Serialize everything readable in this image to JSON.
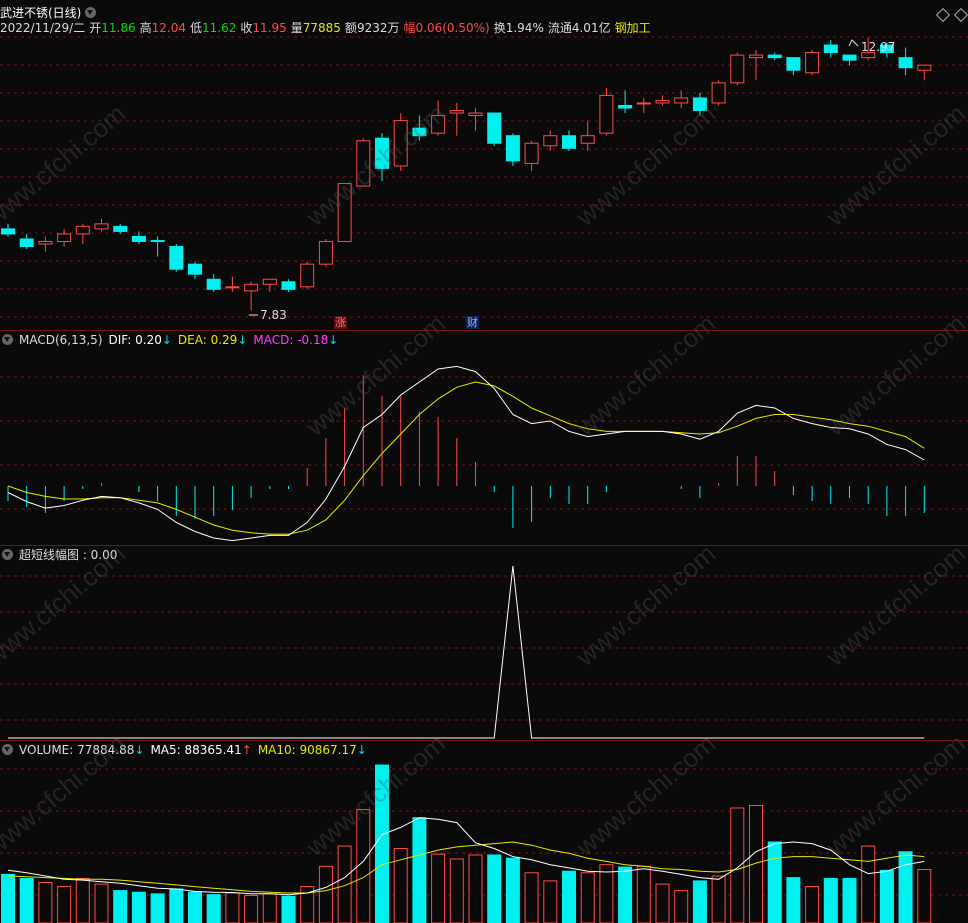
{
  "header": {
    "name": "武进不锈(日线)",
    "date": "2022/11/29/二",
    "open_label": "开",
    "open": "11.86",
    "high_label": "高",
    "high": "12.04",
    "low_label": "低",
    "low": "11.62",
    "close_label": "收",
    "close": "11.95",
    "vol_label": "量",
    "vol": "77885",
    "amount_label": "额",
    "amount": "9232万",
    "change_label": "幅",
    "change": "0.06(0.50%)",
    "turnover_label": "换",
    "turnover": "1.94%",
    "float_label": "流通",
    "float": "4.01亿",
    "sector": "钢加工"
  },
  "price_panel": {
    "high_marker": "12.97",
    "low_marker": "7.83",
    "event_zhang": "涨",
    "event_cai": "财"
  },
  "macd_panel": {
    "title": "MACD(6,13,5)",
    "dif_label": "DIF: 0.20",
    "dea_label": "DEA: 0.29",
    "macd_label": "MACD: -0.18",
    "arrow": "↓"
  },
  "short_panel": {
    "title": "超短线幅图 : 0.00"
  },
  "volume_panel": {
    "vol_label": "VOLUME: 77884.88",
    "ma5_label": "MA5: 88365.41",
    "ma10_label": "MA10: 90867.17",
    "arrow_down": "↓",
    "arrow_up": "↑"
  },
  "watermark": "www.cfchi.com",
  "colors": {
    "up": "#ff4a4a",
    "down": "#00f0f0",
    "dif": "#ffffff",
    "dea": "#e8e800",
    "macd": "#ff40ff",
    "grid": "#7a1111"
  },
  "chart_data": {
    "type": "candlestick",
    "candles": [
      {
        "o": 9.45,
        "h": 9.55,
        "l": 9.3,
        "c": 9.35
      },
      {
        "o": 9.25,
        "h": 9.35,
        "l": 9.05,
        "c": 9.1
      },
      {
        "o": 9.15,
        "h": 9.3,
        "l": 9.0,
        "c": 9.2
      },
      {
        "o": 9.2,
        "h": 9.45,
        "l": 9.1,
        "c": 9.35
      },
      {
        "o": 9.35,
        "h": 9.55,
        "l": 9.15,
        "c": 9.5
      },
      {
        "o": 9.45,
        "h": 9.65,
        "l": 9.4,
        "c": 9.55
      },
      {
        "o": 9.5,
        "h": 9.55,
        "l": 9.35,
        "c": 9.4
      },
      {
        "o": 9.3,
        "h": 9.4,
        "l": 9.15,
        "c": 9.2
      },
      {
        "o": 9.22,
        "h": 9.3,
        "l": 8.9,
        "c": 9.2
      },
      {
        "o": 9.1,
        "h": 9.15,
        "l": 8.6,
        "c": 8.65
      },
      {
        "o": 8.75,
        "h": 8.8,
        "l": 8.45,
        "c": 8.55
      },
      {
        "o": 8.45,
        "h": 8.55,
        "l": 8.2,
        "c": 8.25
      },
      {
        "o": 8.3,
        "h": 8.5,
        "l": 8.2,
        "c": 8.3
      },
      {
        "o": 8.22,
        "h": 8.4,
        "l": 7.83,
        "c": 8.35
      },
      {
        "o": 8.35,
        "h": 8.45,
        "l": 8.2,
        "c": 8.45
      },
      {
        "o": 8.4,
        "h": 8.45,
        "l": 8.2,
        "c": 8.25
      },
      {
        "o": 8.3,
        "h": 8.8,
        "l": 8.25,
        "c": 8.75
      },
      {
        "o": 8.75,
        "h": 9.25,
        "l": 8.7,
        "c": 9.2
      },
      {
        "o": 9.2,
        "h": 10.35,
        "l": 9.2,
        "c": 10.35
      },
      {
        "o": 10.3,
        "h": 11.25,
        "l": 10.3,
        "c": 11.2
      },
      {
        "o": 11.25,
        "h": 11.35,
        "l": 10.4,
        "c": 10.65
      },
      {
        "o": 10.7,
        "h": 11.75,
        "l": 10.6,
        "c": 11.6
      },
      {
        "o": 11.45,
        "h": 11.7,
        "l": 11.2,
        "c": 11.3
      },
      {
        "o": 11.35,
        "h": 12.0,
        "l": 11.3,
        "c": 11.7
      },
      {
        "o": 11.75,
        "h": 11.95,
        "l": 11.3,
        "c": 11.8
      },
      {
        "o": 11.7,
        "h": 11.85,
        "l": 11.4,
        "c": 11.75
      },
      {
        "o": 11.75,
        "h": 11.75,
        "l": 11.1,
        "c": 11.15
      },
      {
        "o": 11.3,
        "h": 11.35,
        "l": 10.7,
        "c": 10.8
      },
      {
        "o": 10.75,
        "h": 11.2,
        "l": 10.6,
        "c": 11.15
      },
      {
        "o": 11.1,
        "h": 11.4,
        "l": 11.0,
        "c": 11.3
      },
      {
        "o": 11.3,
        "h": 11.4,
        "l": 11.0,
        "c": 11.05
      },
      {
        "o": 11.15,
        "h": 11.6,
        "l": 11.0,
        "c": 11.3
      },
      {
        "o": 11.35,
        "h": 12.25,
        "l": 11.3,
        "c": 12.1
      },
      {
        "o": 11.9,
        "h": 12.2,
        "l": 11.75,
        "c": 11.85
      },
      {
        "o": 11.95,
        "h": 12.05,
        "l": 11.75,
        "c": 11.95
      },
      {
        "o": 11.95,
        "h": 12.1,
        "l": 11.9,
        "c": 12.0
      },
      {
        "o": 11.95,
        "h": 12.2,
        "l": 11.85,
        "c": 12.05
      },
      {
        "o": 12.05,
        "h": 12.15,
        "l": 11.7,
        "c": 11.8
      },
      {
        "o": 11.95,
        "h": 12.4,
        "l": 11.9,
        "c": 12.35
      },
      {
        "o": 12.35,
        "h": 12.95,
        "l": 12.3,
        "c": 12.9
      },
      {
        "o": 12.85,
        "h": 13.0,
        "l": 12.4,
        "c": 12.9
      },
      {
        "o": 12.9,
        "h": 12.95,
        "l": 12.8,
        "c": 12.85
      },
      {
        "o": 12.85,
        "h": 12.85,
        "l": 12.5,
        "c": 12.6
      },
      {
        "o": 12.55,
        "h": 13.0,
        "l": 12.5,
        "c": 12.95
      },
      {
        "o": 13.1,
        "h": 13.2,
        "l": 12.85,
        "c": 12.95
      },
      {
        "o": 12.9,
        "h": 12.9,
        "l": 12.7,
        "c": 12.8
      },
      {
        "o": 12.85,
        "h": 13.25,
        "l": 12.8,
        "c": 12.95
      },
      {
        "o": 13.1,
        "h": 13.15,
        "l": 12.85,
        "c": 12.95
      },
      {
        "o": 12.85,
        "h": 13.05,
        "l": 12.5,
        "c": 12.65
      },
      {
        "o": 12.6,
        "h": 12.7,
        "l": 12.4,
        "c": 12.7
      }
    ],
    "dif": [
      -0.05,
      -0.12,
      -0.17,
      -0.15,
      -0.11,
      -0.08,
      -0.09,
      -0.13,
      -0.18,
      -0.28,
      -0.35,
      -0.4,
      -0.42,
      -0.4,
      -0.38,
      -0.38,
      -0.28,
      -0.1,
      0.15,
      0.45,
      0.55,
      0.7,
      0.8,
      0.9,
      0.92,
      0.88,
      0.75,
      0.55,
      0.48,
      0.5,
      0.42,
      0.38,
      0.4,
      0.42,
      0.42,
      0.42,
      0.4,
      0.36,
      0.42,
      0.56,
      0.62,
      0.6,
      0.52,
      0.48,
      0.45,
      0.44,
      0.4,
      0.32,
      0.28,
      0.2
    ],
    "dea": [
      0.0,
      -0.05,
      -0.08,
      -0.1,
      -0.1,
      -0.09,
      -0.09,
      -0.11,
      -0.13,
      -0.18,
      -0.24,
      -0.3,
      -0.34,
      -0.36,
      -0.37,
      -0.37,
      -0.34,
      -0.26,
      -0.11,
      0.08,
      0.25,
      0.4,
      0.55,
      0.67,
      0.76,
      0.8,
      0.77,
      0.69,
      0.6,
      0.54,
      0.48,
      0.44,
      0.42,
      0.42,
      0.42,
      0.42,
      0.41,
      0.4,
      0.41,
      0.46,
      0.52,
      0.55,
      0.55,
      0.53,
      0.51,
      0.48,
      0.46,
      0.42,
      0.38,
      0.29
    ],
    "macd": [
      -0.1,
      -0.14,
      -0.18,
      -0.1,
      -0.02,
      0.02,
      0.0,
      -0.04,
      -0.1,
      -0.2,
      -0.22,
      -0.2,
      -0.16,
      -0.08,
      -0.02,
      -0.02,
      0.12,
      0.32,
      0.52,
      0.74,
      0.6,
      0.6,
      0.5,
      0.46,
      0.32,
      0.16,
      -0.04,
      -0.28,
      -0.24,
      -0.08,
      -0.12,
      -0.12,
      -0.04,
      0.0,
      0.0,
      0.0,
      -0.02,
      -0.08,
      0.02,
      0.2,
      0.2,
      0.1,
      -0.06,
      -0.1,
      -0.12,
      -0.08,
      -0.12,
      -0.2,
      -0.2,
      -0.18
    ],
    "short_amp": [
      0,
      0,
      0,
      0,
      0,
      0,
      0,
      0,
      0,
      0,
      0,
      0,
      0,
      0,
      0,
      0,
      0,
      0,
      0,
      0,
      0,
      0,
      0,
      0,
      0,
      0,
      0,
      1,
      0,
      0,
      0,
      0,
      0,
      0,
      0,
      0,
      0,
      0,
      0,
      0,
      0,
      0,
      0,
      0,
      0,
      0,
      0,
      0,
      0,
      0
    ],
    "volume": [
      60000,
      55000,
      50000,
      45000,
      55000,
      48000,
      40000,
      38000,
      36000,
      42000,
      38000,
      35000,
      37000,
      34000,
      36000,
      33000,
      45000,
      70000,
      95000,
      140000,
      195000,
      92000,
      130000,
      85000,
      79000,
      84000,
      84000,
      80000,
      62000,
      52000,
      64000,
      62000,
      72000,
      69000,
      70000,
      48000,
      40000,
      52000,
      58000,
      142000,
      145000,
      100000,
      56000,
      45000,
      55000,
      55000,
      95000,
      65000,
      88000,
      66000
    ],
    "ma5": [
      65000,
      62000,
      58000,
      54000,
      53000,
      51000,
      49000,
      46000,
      43000,
      42000,
      39000,
      38000,
      37600,
      36000,
      36000,
      35000,
      37000,
      44000,
      56000,
      76000,
      109000,
      118000,
      130000,
      128000,
      124000,
      99000,
      92000,
      82000,
      78000,
      72000,
      68000,
      64000,
      63000,
      64000,
      67000,
      64000,
      60000,
      56000,
      54000,
      68000,
      88000,
      98000,
      100000,
      98000,
      90000,
      72000,
      61000,
      64000,
      72000,
      76000
    ],
    "ma10": [
      58000,
      57000,
      56000,
      55000,
      54000,
      54000,
      53000,
      51000,
      49000,
      47000,
      45000,
      43000,
      41000,
      39000,
      38000,
      37000,
      37000,
      40000,
      46000,
      56000,
      72000,
      78000,
      84000,
      90000,
      94000,
      96000,
      98000,
      100000,
      96000,
      90000,
      86000,
      80000,
      76000,
      72000,
      70000,
      67000,
      66000,
      64000,
      63000,
      66000,
      74000,
      80000,
      82000,
      82000,
      80000,
      78000,
      76000,
      80000,
      84000,
      82000
    ]
  }
}
